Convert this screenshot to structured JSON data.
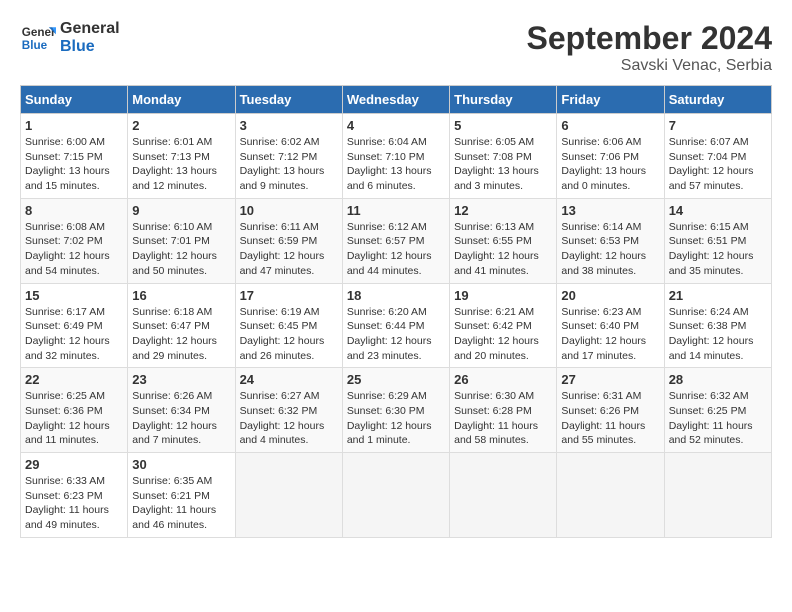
{
  "logo": {
    "line1": "General",
    "line2": "Blue"
  },
  "title": "September 2024",
  "subtitle": "Savski Venac, Serbia",
  "days_of_week": [
    "Sunday",
    "Monday",
    "Tuesday",
    "Wednesday",
    "Thursday",
    "Friday",
    "Saturday"
  ],
  "weeks": [
    [
      {
        "day": "1",
        "sunrise": "6:00 AM",
        "sunset": "7:15 PM",
        "daylight": "13 hours and 15 minutes."
      },
      {
        "day": "2",
        "sunrise": "6:01 AM",
        "sunset": "7:13 PM",
        "daylight": "13 hours and 12 minutes."
      },
      {
        "day": "3",
        "sunrise": "6:02 AM",
        "sunset": "7:12 PM",
        "daylight": "13 hours and 9 minutes."
      },
      {
        "day": "4",
        "sunrise": "6:04 AM",
        "sunset": "7:10 PM",
        "daylight": "13 hours and 6 minutes."
      },
      {
        "day": "5",
        "sunrise": "6:05 AM",
        "sunset": "7:08 PM",
        "daylight": "13 hours and 3 minutes."
      },
      {
        "day": "6",
        "sunrise": "6:06 AM",
        "sunset": "7:06 PM",
        "daylight": "13 hours and 0 minutes."
      },
      {
        "day": "7",
        "sunrise": "6:07 AM",
        "sunset": "7:04 PM",
        "daylight": "12 hours and 57 minutes."
      }
    ],
    [
      {
        "day": "8",
        "sunrise": "6:08 AM",
        "sunset": "7:02 PM",
        "daylight": "12 hours and 54 minutes."
      },
      {
        "day": "9",
        "sunrise": "6:10 AM",
        "sunset": "7:01 PM",
        "daylight": "12 hours and 50 minutes."
      },
      {
        "day": "10",
        "sunrise": "6:11 AM",
        "sunset": "6:59 PM",
        "daylight": "12 hours and 47 minutes."
      },
      {
        "day": "11",
        "sunrise": "6:12 AM",
        "sunset": "6:57 PM",
        "daylight": "12 hours and 44 minutes."
      },
      {
        "day": "12",
        "sunrise": "6:13 AM",
        "sunset": "6:55 PM",
        "daylight": "12 hours and 41 minutes."
      },
      {
        "day": "13",
        "sunrise": "6:14 AM",
        "sunset": "6:53 PM",
        "daylight": "12 hours and 38 minutes."
      },
      {
        "day": "14",
        "sunrise": "6:15 AM",
        "sunset": "6:51 PM",
        "daylight": "12 hours and 35 minutes."
      }
    ],
    [
      {
        "day": "15",
        "sunrise": "6:17 AM",
        "sunset": "6:49 PM",
        "daylight": "12 hours and 32 minutes."
      },
      {
        "day": "16",
        "sunrise": "6:18 AM",
        "sunset": "6:47 PM",
        "daylight": "12 hours and 29 minutes."
      },
      {
        "day": "17",
        "sunrise": "6:19 AM",
        "sunset": "6:45 PM",
        "daylight": "12 hours and 26 minutes."
      },
      {
        "day": "18",
        "sunrise": "6:20 AM",
        "sunset": "6:44 PM",
        "daylight": "12 hours and 23 minutes."
      },
      {
        "day": "19",
        "sunrise": "6:21 AM",
        "sunset": "6:42 PM",
        "daylight": "12 hours and 20 minutes."
      },
      {
        "day": "20",
        "sunrise": "6:23 AM",
        "sunset": "6:40 PM",
        "daylight": "12 hours and 17 minutes."
      },
      {
        "day": "21",
        "sunrise": "6:24 AM",
        "sunset": "6:38 PM",
        "daylight": "12 hours and 14 minutes."
      }
    ],
    [
      {
        "day": "22",
        "sunrise": "6:25 AM",
        "sunset": "6:36 PM",
        "daylight": "12 hours and 11 minutes."
      },
      {
        "day": "23",
        "sunrise": "6:26 AM",
        "sunset": "6:34 PM",
        "daylight": "12 hours and 7 minutes."
      },
      {
        "day": "24",
        "sunrise": "6:27 AM",
        "sunset": "6:32 PM",
        "daylight": "12 hours and 4 minutes."
      },
      {
        "day": "25",
        "sunrise": "6:29 AM",
        "sunset": "6:30 PM",
        "daylight": "12 hours and 1 minute."
      },
      {
        "day": "26",
        "sunrise": "6:30 AM",
        "sunset": "6:28 PM",
        "daylight": "11 hours and 58 minutes."
      },
      {
        "day": "27",
        "sunrise": "6:31 AM",
        "sunset": "6:26 PM",
        "daylight": "11 hours and 55 minutes."
      },
      {
        "day": "28",
        "sunrise": "6:32 AM",
        "sunset": "6:25 PM",
        "daylight": "11 hours and 52 minutes."
      }
    ],
    [
      {
        "day": "29",
        "sunrise": "6:33 AM",
        "sunset": "6:23 PM",
        "daylight": "11 hours and 49 minutes."
      },
      {
        "day": "30",
        "sunrise": "6:35 AM",
        "sunset": "6:21 PM",
        "daylight": "11 hours and 46 minutes."
      },
      null,
      null,
      null,
      null,
      null
    ]
  ]
}
